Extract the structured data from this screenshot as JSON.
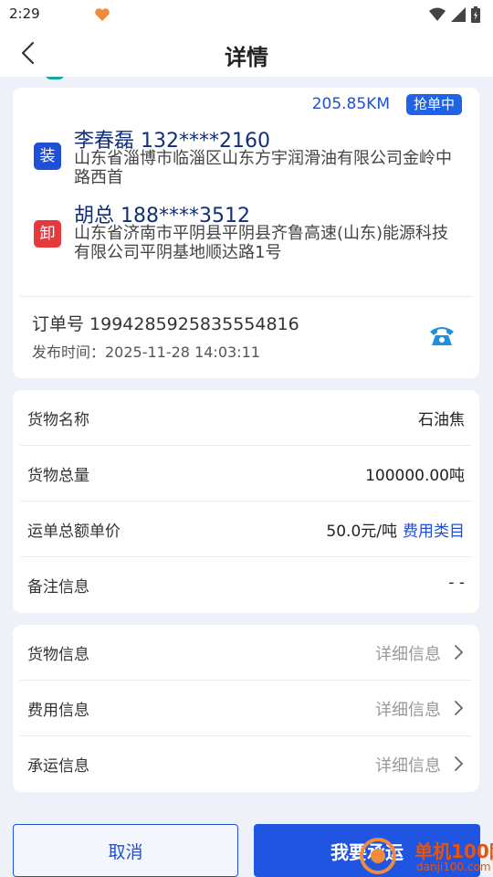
{
  "status_bar": {
    "time": "2:29"
  },
  "header": {
    "title": "详情"
  },
  "route": {
    "distance": "205.85KM",
    "status_badge": "抢单中",
    "loading": {
      "tag": "装",
      "contact": "李春磊 132****2160",
      "address": "山东省淄博市临淄区山东方宇润滑油有限公司金岭中路西首"
    },
    "unloading": {
      "tag": "卸",
      "contact": "胡总 188****3512",
      "address": "山东省济南市平阴县平阴县齐鲁高速(山东)能源科技有限公司平阴基地顺达路1号"
    },
    "order_no": "订单号 1994285925835554816",
    "publish_time": "发布时间：2025-11-28 14:03:11"
  },
  "cargo": {
    "rows": [
      {
        "label": "货物名称",
        "value": "石油焦"
      },
      {
        "label": "货物总量",
        "value": "100000.00吨"
      },
      {
        "label": "运单总额单价",
        "value": "50.0元/吨",
        "link": "费用类目"
      },
      {
        "label": "备注信息",
        "value": "- -"
      }
    ]
  },
  "info": {
    "rows": [
      {
        "label": "货物信息",
        "more": "详细信息"
      },
      {
        "label": "费用信息",
        "more": "详细信息"
      },
      {
        "label": "承运信息",
        "more": "详细信息"
      }
    ]
  },
  "actions": {
    "cancel": "取消",
    "accept": "我要承运"
  },
  "watermark": {
    "name": "单机100网",
    "url": "danji100.com"
  },
  "icons": {
    "back": "chevron-left-icon",
    "phone": "phone-icon",
    "more": "chevron-right-icon",
    "status": [
      "wifi-icon",
      "signal-icon",
      "battery-icon"
    ]
  },
  "colors": {
    "primary": "#1f4fd6",
    "load_tag": "#1f4fd6",
    "unload_tag": "#e6393e",
    "background": "#eef1f7"
  }
}
